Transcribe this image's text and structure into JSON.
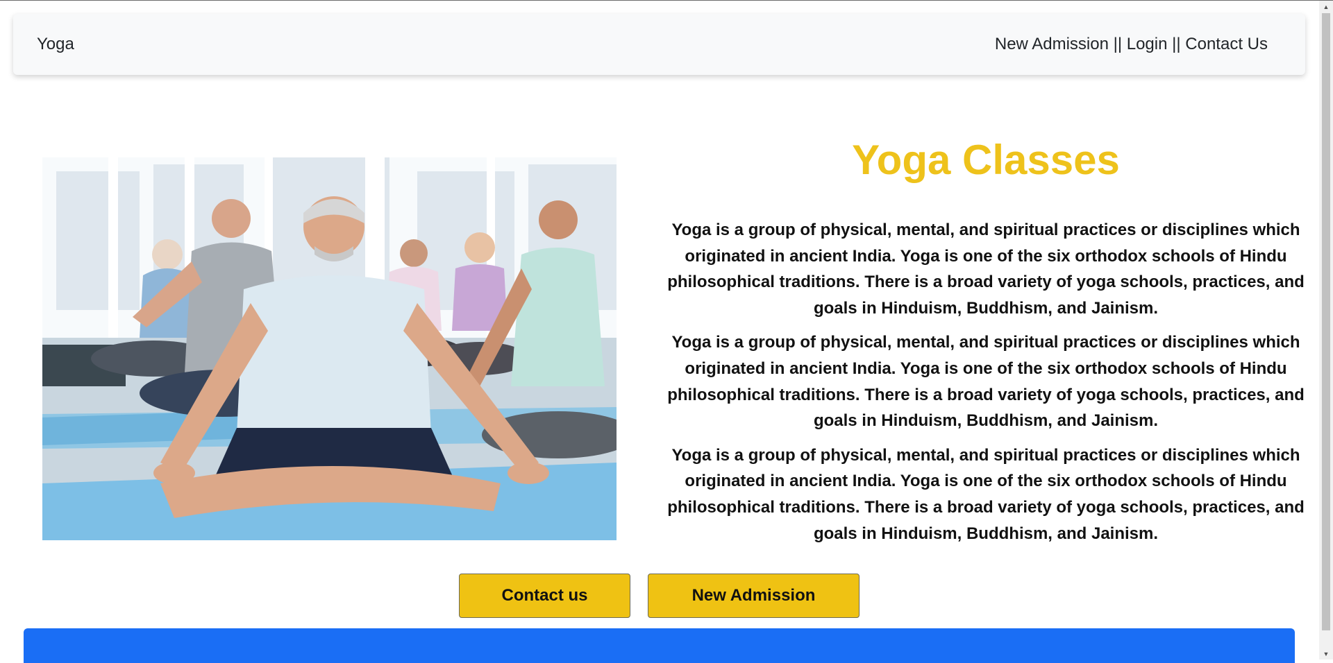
{
  "navbar": {
    "brand": "Yoga",
    "links": [
      {
        "label": "New Admission"
      },
      {
        "label": "Login"
      },
      {
        "label": "Contact Us"
      }
    ],
    "separator": " || "
  },
  "hero": {
    "title": "Yoga Classes",
    "paragraphs": [
      "Yoga is a group of physical, mental, and spiritual practices or disciplines which originated in ancient India. Yoga is one of the six orthodox schools of Hindu philosophical traditions. There is a broad variety of yoga schools, practices, and goals in Hinduism, Buddhism, and Jainism.",
      "Yoga is a group of physical, mental, and spiritual practices or disciplines which originated in ancient India. Yoga is one of the six orthodox schools of Hindu philosophical traditions. There is a broad variety of yoga schools, practices, and goals in Hinduism, Buddhism, and Jainism.",
      "Yoga is a group of physical, mental, and spiritual practices or disciplines which originated in ancient India. Yoga is one of the six orthodox schools of Hindu philosophical traditions. There is a broad variety of yoga schools, practices, and goals in Hinduism, Buddhism, and Jainism."
    ]
  },
  "buttons": {
    "contact": "Contact us",
    "admission": "New Admission"
  },
  "colors": {
    "accent_yellow": "#efc213",
    "title_yellow": "#eec21b",
    "footer_blue": "#1a6ef5",
    "navbar_bg": "#f8f9fa"
  }
}
